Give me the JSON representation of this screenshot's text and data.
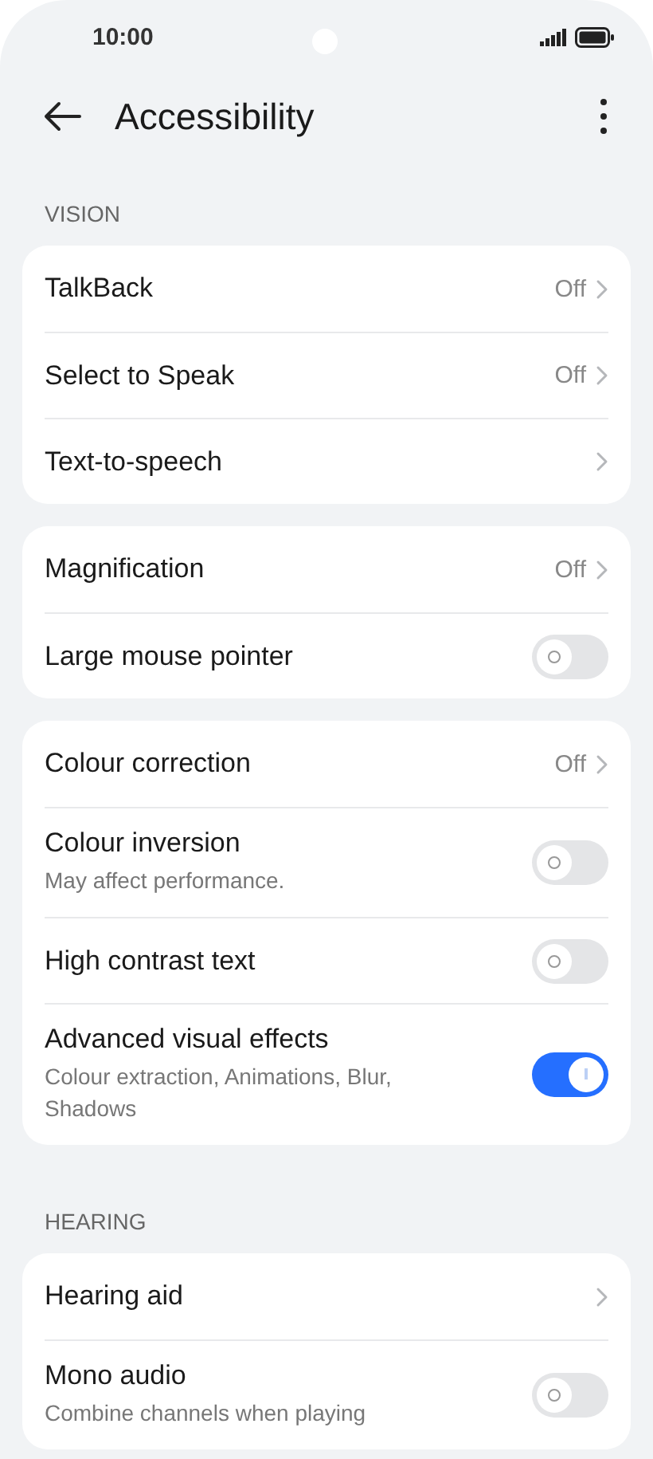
{
  "status_bar": {
    "time": "10:00"
  },
  "header": {
    "title": "Accessibility"
  },
  "sections": [
    {
      "label": "VISION",
      "groups": [
        [
          {
            "kind": "link",
            "title": "TalkBack",
            "value": "Off"
          },
          {
            "kind": "link",
            "title": "Select to Speak",
            "value": "Off"
          },
          {
            "kind": "link",
            "title": "Text-to-speech"
          }
        ],
        [
          {
            "kind": "link",
            "title": "Magnification",
            "value": "Off"
          },
          {
            "kind": "toggle",
            "title": "Large mouse pointer",
            "on": false
          }
        ],
        [
          {
            "kind": "link",
            "title": "Colour correction",
            "value": "Off"
          },
          {
            "kind": "toggle",
            "title": "Colour inversion",
            "subtitle": "May affect performance.",
            "on": false
          },
          {
            "kind": "toggle",
            "title": "High contrast text",
            "on": false
          },
          {
            "kind": "toggle",
            "title": "Advanced visual effects",
            "subtitle": "Colour extraction, Animations, Blur, Shadows",
            "on": true
          }
        ]
      ]
    },
    {
      "label": "HEARING",
      "groups": [
        [
          {
            "kind": "link",
            "title": "Hearing aid"
          },
          {
            "kind": "toggle",
            "title": "Mono audio",
            "subtitle": "Combine channels when playing",
            "on": false
          }
        ]
      ]
    }
  ]
}
